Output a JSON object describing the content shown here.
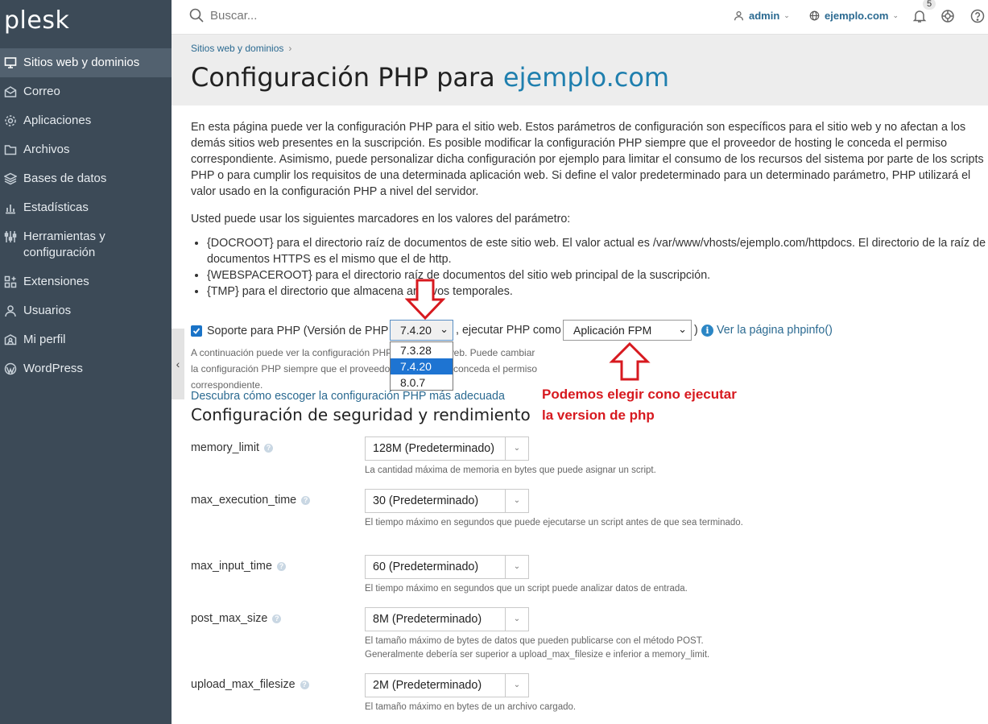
{
  "logo": "plesk",
  "sidebar": {
    "items": [
      {
        "label": "Sitios web y dominios",
        "icon": "monitor-icon",
        "active": true
      },
      {
        "label": "Correo",
        "icon": "mail-icon",
        "active": false
      },
      {
        "label": "Aplicaciones",
        "icon": "gear-icon",
        "active": false
      },
      {
        "label": "Archivos",
        "icon": "folder-icon",
        "active": false
      },
      {
        "label": "Bases de datos",
        "icon": "layers-icon",
        "active": false
      },
      {
        "label": "Estadísticas",
        "icon": "bar-chart-icon",
        "active": false
      },
      {
        "label": "Herramientas y configuración",
        "icon": "sliders-icon",
        "active": false
      },
      {
        "label": "Extensiones",
        "icon": "extensions-icon",
        "active": false
      },
      {
        "label": "Usuarios",
        "icon": "user-icon",
        "active": false
      },
      {
        "label": "Mi perfil",
        "icon": "id-card-icon",
        "active": false
      },
      {
        "label": "WordPress",
        "icon": "wordpress-icon",
        "active": false
      }
    ]
  },
  "topbar": {
    "search_placeholder": "Buscar...",
    "user": "admin",
    "domain": "ejemplo.com",
    "notifications_count": "5"
  },
  "header": {
    "breadcrumb": "Sitios web y dominios",
    "title_prefix": "Configuración PHP para ",
    "title_domain": "ejemplo.com"
  },
  "intro": "En esta página puede ver la configuración PHP para el sitio web. Estos parámetros de configuración son específicos para el sitio web y no afectan a los demás sitios web presentes en la suscripción. Es posible modificar la configuración PHP siempre que el proveedor de hosting le conceda el permiso correspondiente. Asimismo, puede personalizar dicha configuración por ejemplo para limitar el consumo de los recursos del sistema por parte de los scripts PHP o para cumplir los requisitos de una determinada aplicación web. Si define el valor predeterminado para un determinado parámetro, PHP utilizará el valor usado en la configuración PHP a nivel del servidor.",
  "markers_intro": "Usted puede usar los siguientes marcadores en los valores del parámetro:",
  "markers": [
    "{DOCROOT} para el directorio raíz de documentos de este sitio web. El valor actual es /var/www/vhosts/ejemplo.com/httpdocs. El directorio de la raíz de documentos HTTPS es el mismo que el de http.",
    "{WEBSPACEROOT} para el directorio raíz de documentos del sitio web principal de la suscripción.",
    "{TMP} para el directorio que almacena archivos temporales."
  ],
  "php_support": {
    "label": "Soporte para PHP (Versión de PHP",
    "selected_version": "7.4.20",
    "version_options": [
      "7.3.28",
      "7.4.20",
      "8.0.7"
    ],
    "run_as_label": ", ejecutar PHP como",
    "handler": "Aplicación FPM",
    "close_paren": ")",
    "phpinfo_link": "Ver la página phpinfo()",
    "help_text": "A continuación puede ver la configuración PHP para el sitio web. Puede cambiar la configuración PHP siempre que el proveedor de hosting le conceda el permiso correspondiente.",
    "choose_link": "Descubra cómo escoger la configuración PHP más adecuada"
  },
  "annotation": {
    "text_line1": "Podemos elegir cono ejecutar",
    "text_line2": "la version de php",
    "color": "#d7191f"
  },
  "security": {
    "title": "Configuración de seguridad y rendimiento",
    "settings": [
      {
        "name": "memory_limit",
        "value": "128M (Predeterminado)",
        "desc": "La cantidad máxima de memoria en bytes que puede asignar un script."
      },
      {
        "name": "max_execution_time",
        "value": "30 (Predeterminado)",
        "desc": "El tiempo máximo en segundos que puede ejecutarse un script antes de que sea terminado."
      },
      {
        "name": "max_input_time",
        "value": "60 (Predeterminado)",
        "desc": "El tiempo máximo en segundos que un script puede analizar datos de entrada."
      },
      {
        "name": "post_max_size",
        "value": "8M (Predeterminado)",
        "desc": "El tamaño máximo de bytes de datos que pueden publicarse con el método POST. Generalmente debería ser superior a upload_max_filesize e inferior a memory_limit."
      },
      {
        "name": "upload_max_filesize",
        "value": "2M (Predeterminado)",
        "desc": "El tamaño máximo en bytes de un archivo cargado."
      }
    ]
  }
}
